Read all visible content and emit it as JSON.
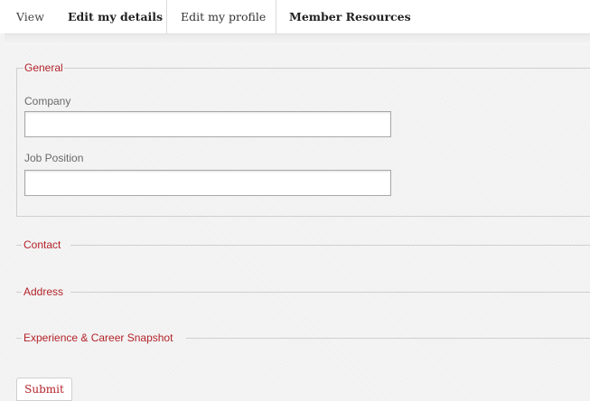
{
  "tabs": [
    {
      "label": "View"
    },
    {
      "label": "Edit my details"
    },
    {
      "label": "Edit my profile",
      "active": true
    },
    {
      "label": "Member Resources"
    }
  ],
  "sections": {
    "general": {
      "legend": "General",
      "fields": [
        {
          "label": "Company",
          "value": "",
          "placeholder": ""
        },
        {
          "label": "Job Position",
          "value": "",
          "placeholder": ""
        }
      ]
    },
    "contact": {
      "legend": "Contact"
    },
    "address": {
      "legend": "Address"
    },
    "experience": {
      "legend": "Experience & Career Snapshot"
    }
  },
  "submit_label": "Submit",
  "colors": {
    "legend_red": "#b3232a",
    "background": "#f1f1f1",
    "border": "#cfcfcf"
  }
}
